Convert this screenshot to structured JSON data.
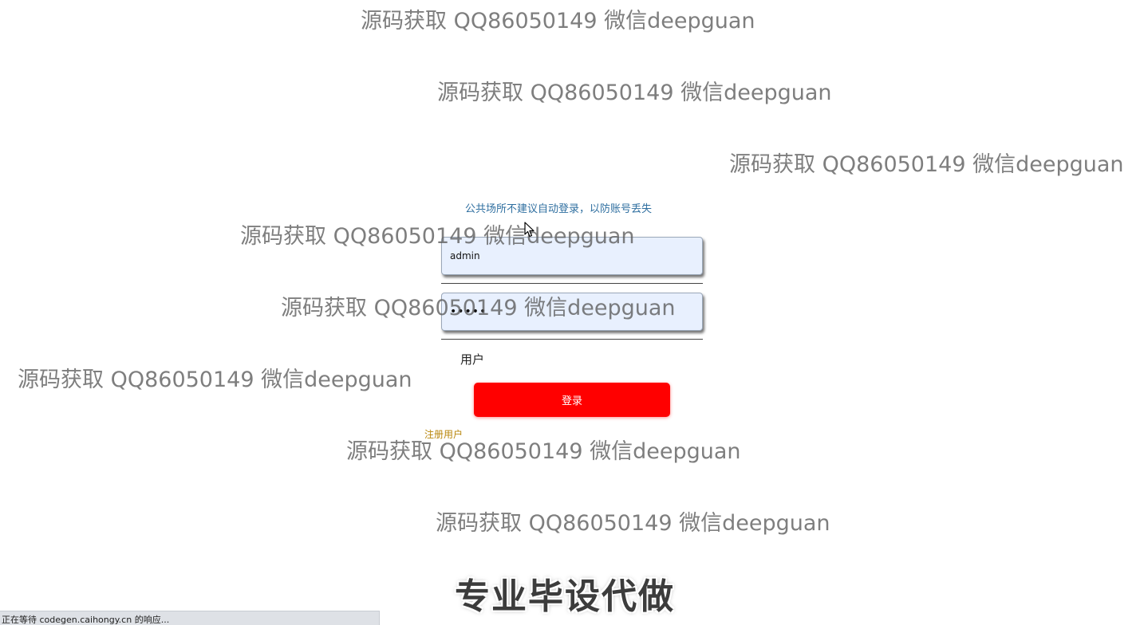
{
  "login": {
    "notice": "公共场所不建议自动登录，以防账号丢失",
    "username_value": "admin",
    "password_value": "•••••",
    "role_label": "用户",
    "login_button": "登录",
    "register_link": "注册用户"
  },
  "watermarks": [
    "源码获取 QQ86050149 微信deepguan",
    "源码获取 QQ86050149 微信deepguan",
    "源码获取 QQ86050149 微信deepguan",
    "源码获取 QQ86050149 微信deepguan",
    "源码获取 QQ86050149 微信deepguan",
    "源码获取 QQ86050149 微信deepguan",
    "源码获取 QQ86050149 微信deepguan",
    "源码获取 QQ86050149 微信deepguan"
  ],
  "banner": "专业毕设代做",
  "status_bar": "正在等待 codegen.caihongy.cn 的响应...",
  "colors": {
    "login_button": "#ff0000",
    "notice_text": "#2f6fa0",
    "register_link": "#b8860b",
    "input_background": "#e8f0fe"
  },
  "icons": {
    "cursor": "arrow-cursor-icon"
  }
}
